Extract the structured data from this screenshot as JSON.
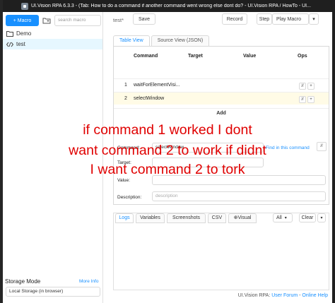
{
  "window": {
    "title": "UI.Vision RPA 6.3.3 - (Tab: How to do a command if another command went wrong else dont do? - UI.Vision RPA / HowTo - UI..."
  },
  "sidebar": {
    "new_macro": "+ Macro",
    "search_placeholder": "search macro",
    "items": [
      {
        "label": "Demo",
        "icon": "folder-icon"
      },
      {
        "label": "test",
        "icon": "code-icon"
      }
    ],
    "storage_title": "Storage Mode",
    "more_info": "More Info",
    "storage_value": "Local Storage (in browser)"
  },
  "toolbar": {
    "macro_name": "test*",
    "save": "Save",
    "record": "Record",
    "step": "Step",
    "play": "Play Macro"
  },
  "tabs": [
    {
      "label": "Table View",
      "active": true
    },
    {
      "label": "Source View (JSON)",
      "active": false
    }
  ],
  "table": {
    "headers": [
      "Command",
      "Target",
      "Value",
      "Ops"
    ],
    "rows": [
      {
        "index": "1",
        "command": "waitForElementVisi...",
        "highlighted": false
      },
      {
        "index": "2",
        "command": "selectWindow",
        "highlighted": true
      }
    ],
    "add": "Add"
  },
  "editor": {
    "command_label": "Command:",
    "command_value": "selectWindow",
    "find_link": "Find in this command",
    "target_label": "Target:",
    "value_label": "Value:",
    "description_label": "Description:",
    "description_placeholder": "description"
  },
  "log_tabs": [
    "Logs",
    "Variables",
    "Screenshots",
    "CSV",
    "Visual"
  ],
  "log_filter": "All",
  "clear": "Clear",
  "footer": {
    "prefix": "UI.Vision RPA: ",
    "forum": "User Forum",
    "sep": " - ",
    "help": "Online Help"
  },
  "overlay": {
    "line1": "if command 1 worked I dont",
    "line2": "want command 2 to work if didnt",
    "line3": "I want command 2 to tork"
  },
  "colors": {
    "accent": "#1890ff",
    "overlay_text": "#e00000",
    "highlight_row": "#fffbe6"
  }
}
